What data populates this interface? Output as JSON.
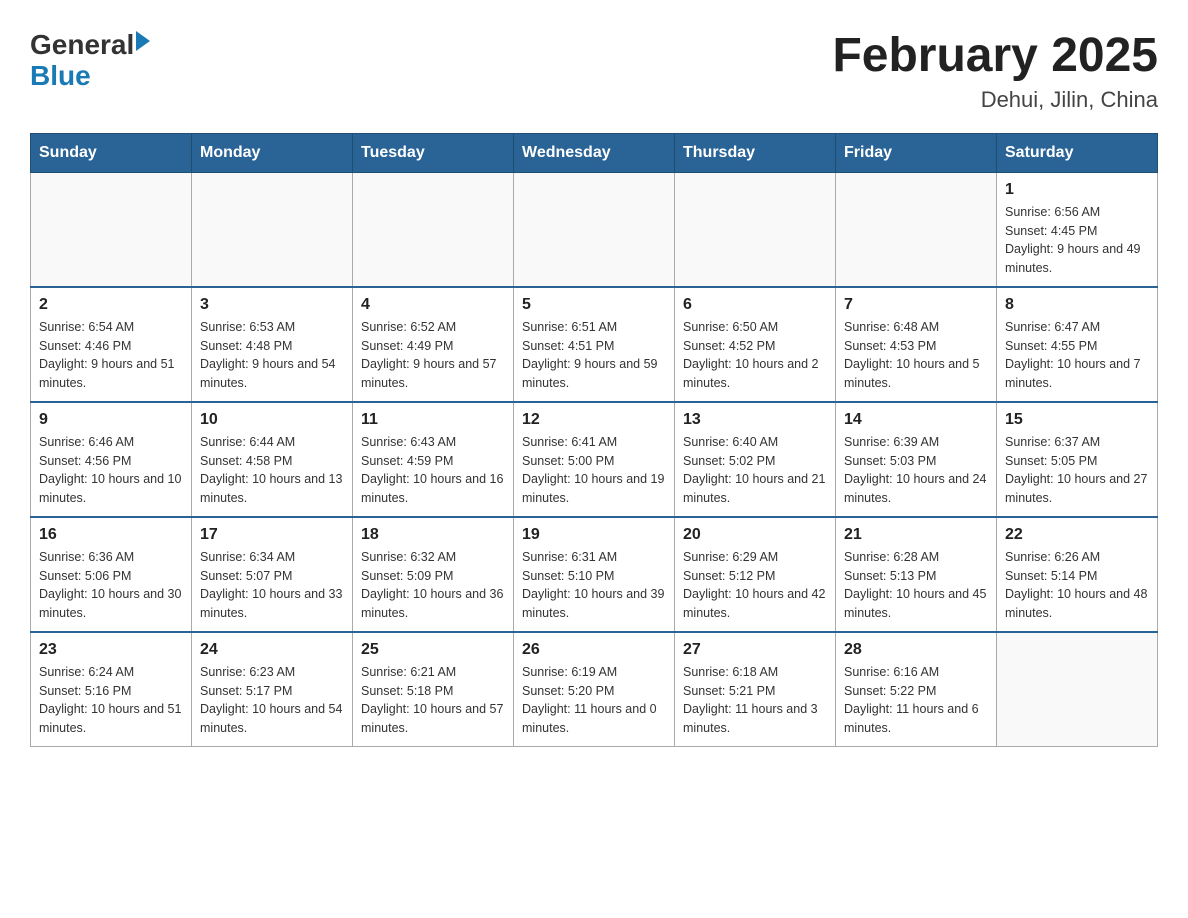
{
  "header": {
    "logo_general": "General",
    "logo_blue": "Blue",
    "title": "February 2025",
    "location": "Dehui, Jilin, China"
  },
  "weekdays": [
    "Sunday",
    "Monday",
    "Tuesday",
    "Wednesday",
    "Thursday",
    "Friday",
    "Saturday"
  ],
  "weeks": [
    [
      {
        "day": "",
        "info": ""
      },
      {
        "day": "",
        "info": ""
      },
      {
        "day": "",
        "info": ""
      },
      {
        "day": "",
        "info": ""
      },
      {
        "day": "",
        "info": ""
      },
      {
        "day": "",
        "info": ""
      },
      {
        "day": "1",
        "info": "Sunrise: 6:56 AM\nSunset: 4:45 PM\nDaylight: 9 hours and 49 minutes."
      }
    ],
    [
      {
        "day": "2",
        "info": "Sunrise: 6:54 AM\nSunset: 4:46 PM\nDaylight: 9 hours and 51 minutes."
      },
      {
        "day": "3",
        "info": "Sunrise: 6:53 AM\nSunset: 4:48 PM\nDaylight: 9 hours and 54 minutes."
      },
      {
        "day": "4",
        "info": "Sunrise: 6:52 AM\nSunset: 4:49 PM\nDaylight: 9 hours and 57 minutes."
      },
      {
        "day": "5",
        "info": "Sunrise: 6:51 AM\nSunset: 4:51 PM\nDaylight: 9 hours and 59 minutes."
      },
      {
        "day": "6",
        "info": "Sunrise: 6:50 AM\nSunset: 4:52 PM\nDaylight: 10 hours and 2 minutes."
      },
      {
        "day": "7",
        "info": "Sunrise: 6:48 AM\nSunset: 4:53 PM\nDaylight: 10 hours and 5 minutes."
      },
      {
        "day": "8",
        "info": "Sunrise: 6:47 AM\nSunset: 4:55 PM\nDaylight: 10 hours and 7 minutes."
      }
    ],
    [
      {
        "day": "9",
        "info": "Sunrise: 6:46 AM\nSunset: 4:56 PM\nDaylight: 10 hours and 10 minutes."
      },
      {
        "day": "10",
        "info": "Sunrise: 6:44 AM\nSunset: 4:58 PM\nDaylight: 10 hours and 13 minutes."
      },
      {
        "day": "11",
        "info": "Sunrise: 6:43 AM\nSunset: 4:59 PM\nDaylight: 10 hours and 16 minutes."
      },
      {
        "day": "12",
        "info": "Sunrise: 6:41 AM\nSunset: 5:00 PM\nDaylight: 10 hours and 19 minutes."
      },
      {
        "day": "13",
        "info": "Sunrise: 6:40 AM\nSunset: 5:02 PM\nDaylight: 10 hours and 21 minutes."
      },
      {
        "day": "14",
        "info": "Sunrise: 6:39 AM\nSunset: 5:03 PM\nDaylight: 10 hours and 24 minutes."
      },
      {
        "day": "15",
        "info": "Sunrise: 6:37 AM\nSunset: 5:05 PM\nDaylight: 10 hours and 27 minutes."
      }
    ],
    [
      {
        "day": "16",
        "info": "Sunrise: 6:36 AM\nSunset: 5:06 PM\nDaylight: 10 hours and 30 minutes."
      },
      {
        "day": "17",
        "info": "Sunrise: 6:34 AM\nSunset: 5:07 PM\nDaylight: 10 hours and 33 minutes."
      },
      {
        "day": "18",
        "info": "Sunrise: 6:32 AM\nSunset: 5:09 PM\nDaylight: 10 hours and 36 minutes."
      },
      {
        "day": "19",
        "info": "Sunrise: 6:31 AM\nSunset: 5:10 PM\nDaylight: 10 hours and 39 minutes."
      },
      {
        "day": "20",
        "info": "Sunrise: 6:29 AM\nSunset: 5:12 PM\nDaylight: 10 hours and 42 minutes."
      },
      {
        "day": "21",
        "info": "Sunrise: 6:28 AM\nSunset: 5:13 PM\nDaylight: 10 hours and 45 minutes."
      },
      {
        "day": "22",
        "info": "Sunrise: 6:26 AM\nSunset: 5:14 PM\nDaylight: 10 hours and 48 minutes."
      }
    ],
    [
      {
        "day": "23",
        "info": "Sunrise: 6:24 AM\nSunset: 5:16 PM\nDaylight: 10 hours and 51 minutes."
      },
      {
        "day": "24",
        "info": "Sunrise: 6:23 AM\nSunset: 5:17 PM\nDaylight: 10 hours and 54 minutes."
      },
      {
        "day": "25",
        "info": "Sunrise: 6:21 AM\nSunset: 5:18 PM\nDaylight: 10 hours and 57 minutes."
      },
      {
        "day": "26",
        "info": "Sunrise: 6:19 AM\nSunset: 5:20 PM\nDaylight: 11 hours and 0 minutes."
      },
      {
        "day": "27",
        "info": "Sunrise: 6:18 AM\nSunset: 5:21 PM\nDaylight: 11 hours and 3 minutes."
      },
      {
        "day": "28",
        "info": "Sunrise: 6:16 AM\nSunset: 5:22 PM\nDaylight: 11 hours and 6 minutes."
      },
      {
        "day": "",
        "info": ""
      }
    ]
  ]
}
